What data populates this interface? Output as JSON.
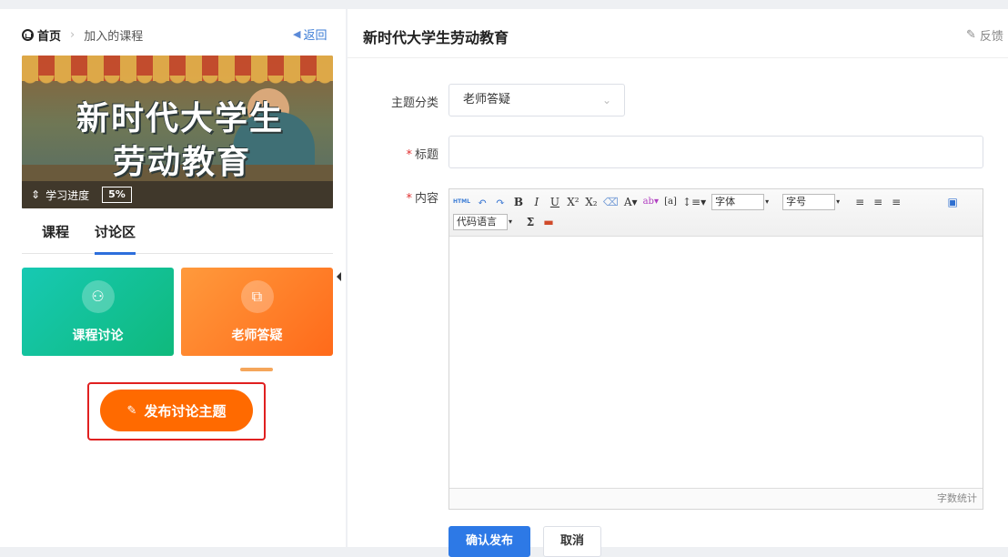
{
  "breadcrumb": {
    "home": "首页",
    "current": "加入的课程",
    "back": "返回"
  },
  "course": {
    "cover_line1": "新时代大学生",
    "cover_line2": "劳动教育",
    "progress_label": "学习进度",
    "progress_value": "5%"
  },
  "tabs": [
    {
      "label": "课程"
    },
    {
      "label": "讨论区",
      "active": true
    }
  ],
  "cards": [
    {
      "label": "课程讨论",
      "icon": "people-icon",
      "color": "#14c09a"
    },
    {
      "label": "老师答疑",
      "icon": "question-board-icon",
      "color": "#ff7a22"
    }
  ],
  "post_button": {
    "label": "发布讨论主题",
    "color": "#ff6a00"
  },
  "form": {
    "title": "新时代大学生劳动教育",
    "feedback": "反馈",
    "category_label": "主题分类",
    "category_value": "老师答疑",
    "title_label": "标题",
    "title_value": "",
    "content_label": "内容",
    "toolbar": {
      "html": "HTML",
      "font_select": "字体",
      "size_select": "字号",
      "code_lang_select": "代码语言",
      "sigma": "Σ"
    },
    "word_count": "字数统计",
    "submit": "确认发布",
    "cancel": "取消"
  },
  "colors": {
    "accent_blue": "#2d79e6",
    "orange": "#ff6a00",
    "teal": "#14c09a",
    "highlight_red": "#e02020"
  }
}
